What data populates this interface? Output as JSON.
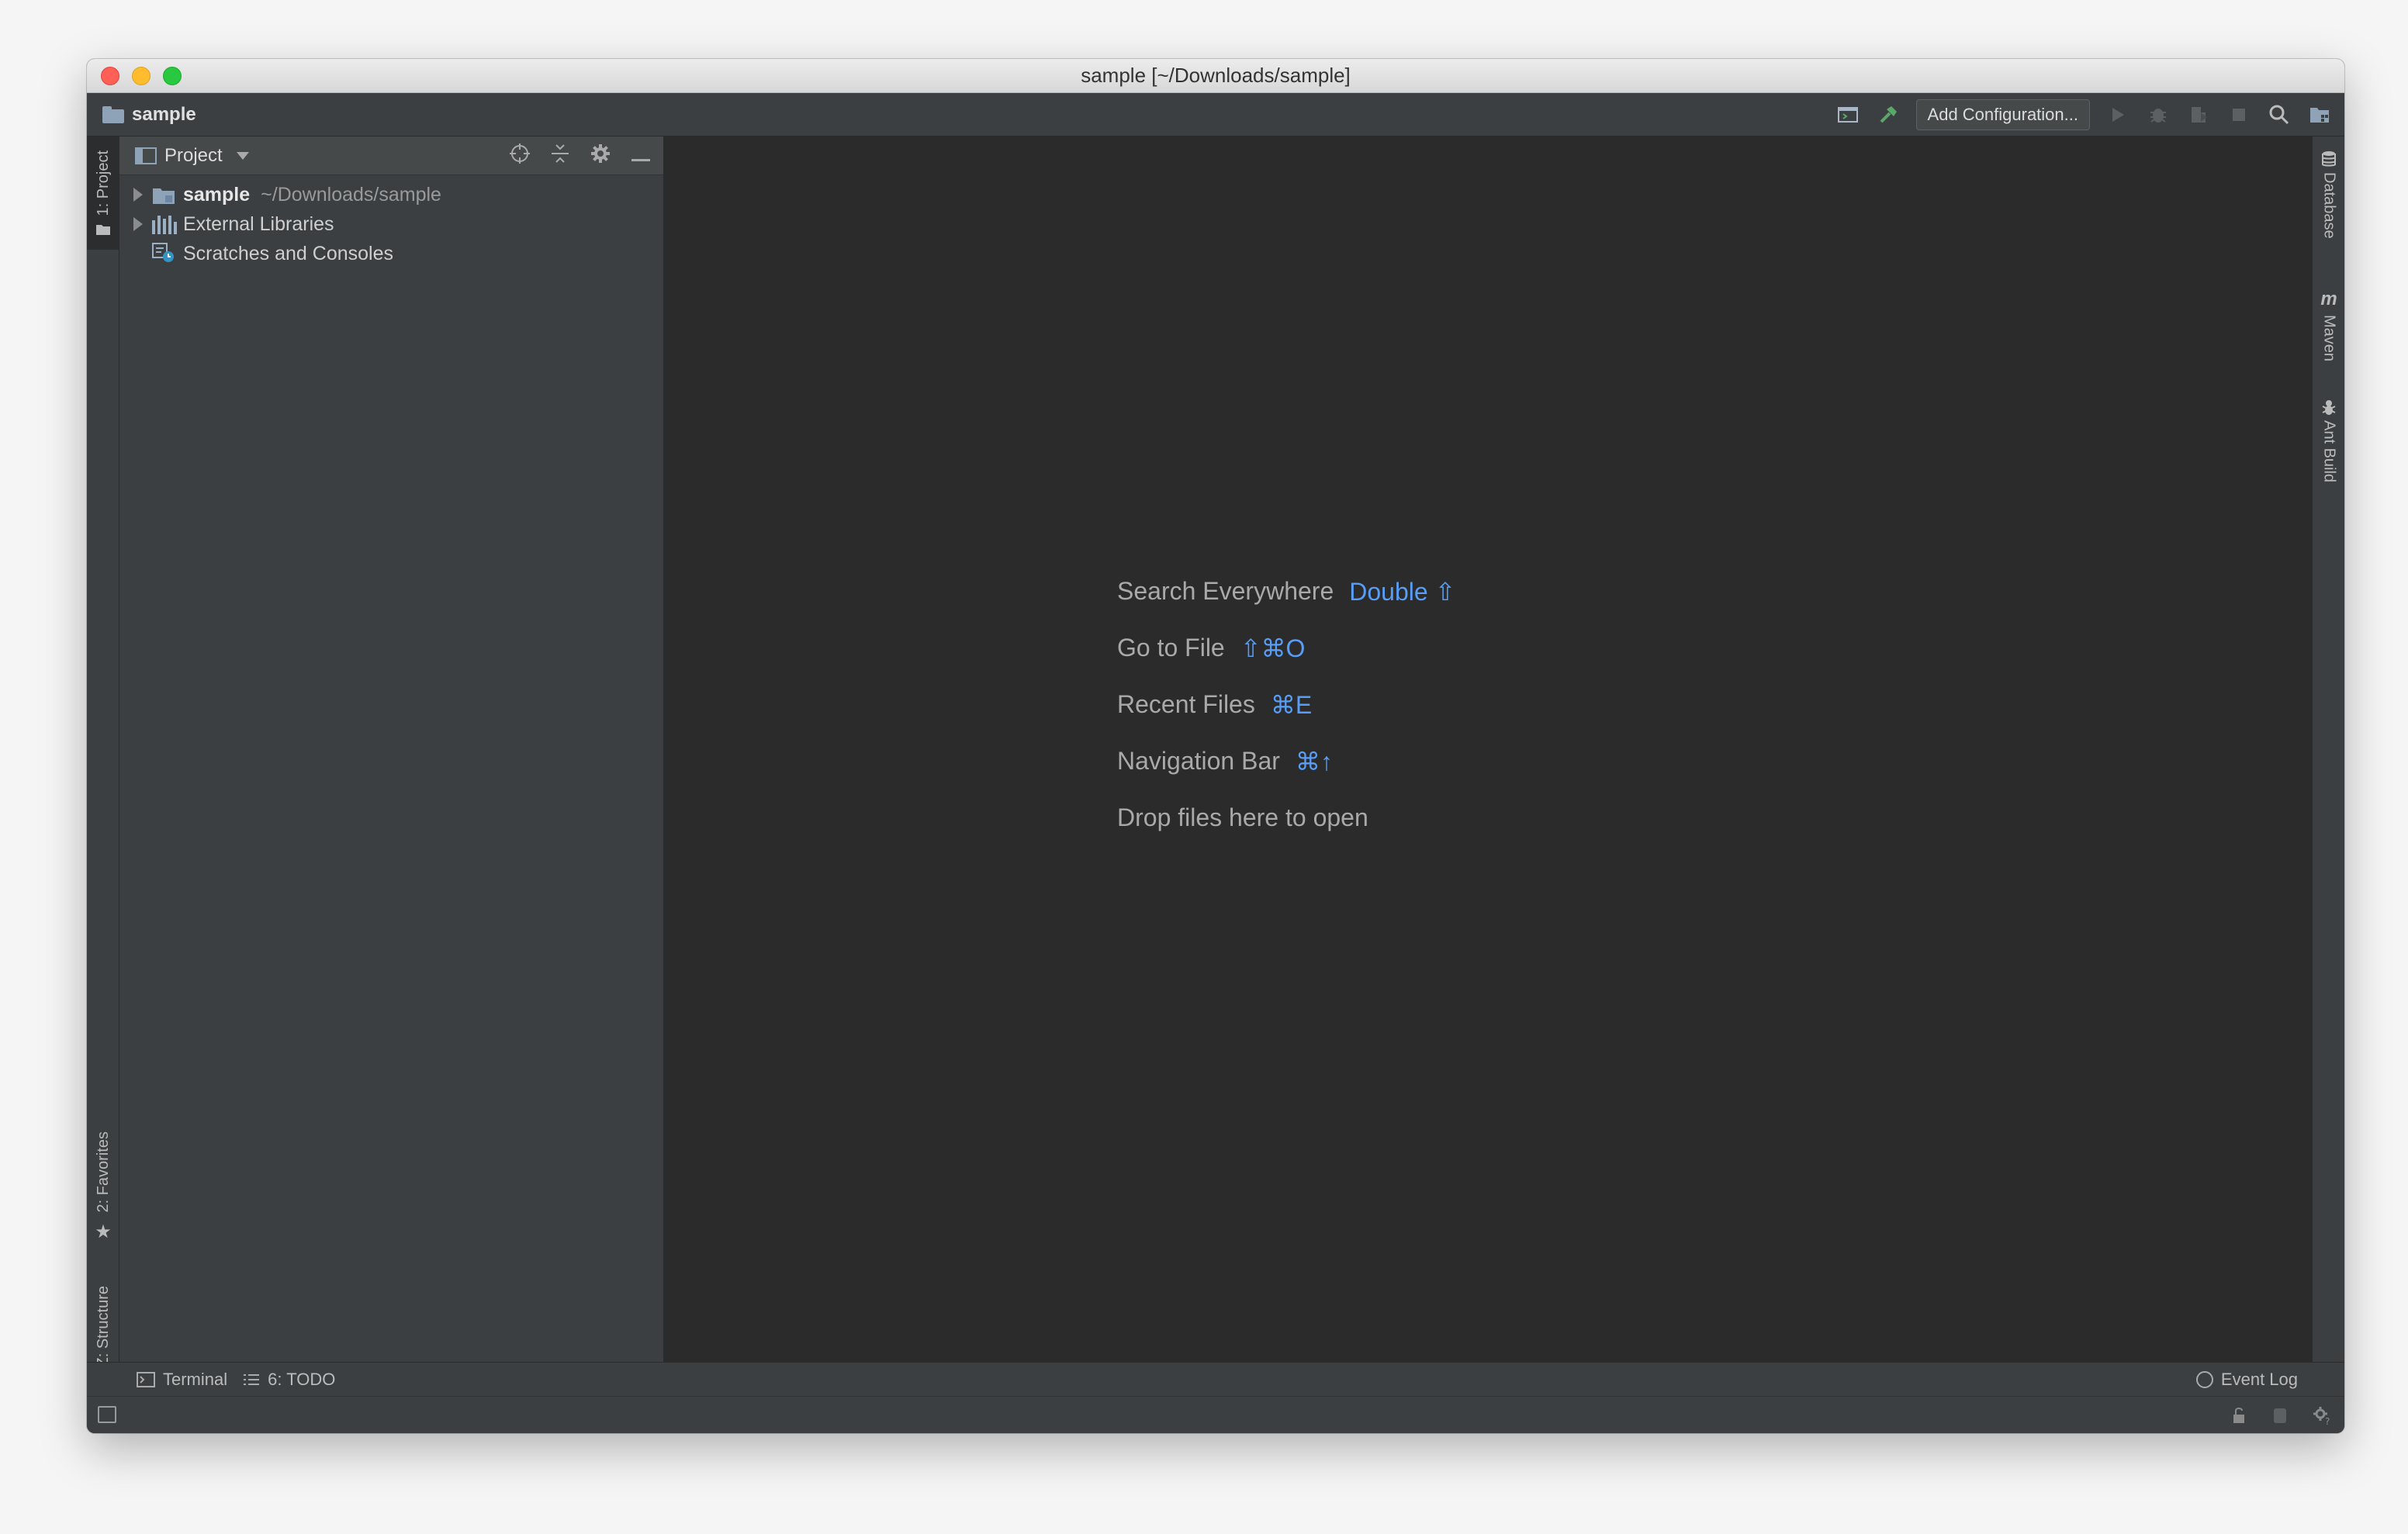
{
  "window": {
    "title": "sample [~/Downloads/sample]"
  },
  "navbar": {
    "project_name": "sample",
    "add_configuration_label": "Add Configuration...",
    "icons": [
      "run-config-icon",
      "build-hammer-icon",
      "run-icon",
      "debug-icon",
      "coverage-icon",
      "stop-icon",
      "search-icon",
      "project-structure-icon"
    ]
  },
  "left_stripe": {
    "project_tab": "1: Project",
    "favorites_tab": "2: Favorites",
    "structure_tab": "Z: Structure"
  },
  "right_stripe": {
    "database_tab": "Database",
    "maven_tab": "Maven",
    "maven_glyph": "m",
    "ant_tab": "Ant Build"
  },
  "project_panel": {
    "view_label": "Project",
    "tree": [
      {
        "label": "sample",
        "path": "~/Downloads/sample",
        "expandable": true
      },
      {
        "label": "External Libraries",
        "expandable": true
      },
      {
        "label": "Scratches and Consoles",
        "expandable": false
      }
    ]
  },
  "editor": {
    "hints": [
      {
        "label": "Search Everywhere",
        "shortcut": "Double ⇧"
      },
      {
        "label": "Go to File",
        "shortcut": "⇧⌘O"
      },
      {
        "label": "Recent Files",
        "shortcut": "⌘E"
      },
      {
        "label": "Navigation Bar",
        "shortcut": "⌘↑"
      },
      {
        "label": "Drop files here to open",
        "shortcut": ""
      }
    ],
    "accent_color": "#589df6"
  },
  "bottom_bar": {
    "terminal_label": "Terminal",
    "todo_label": "6: TODO",
    "event_log_label": "Event Log"
  }
}
